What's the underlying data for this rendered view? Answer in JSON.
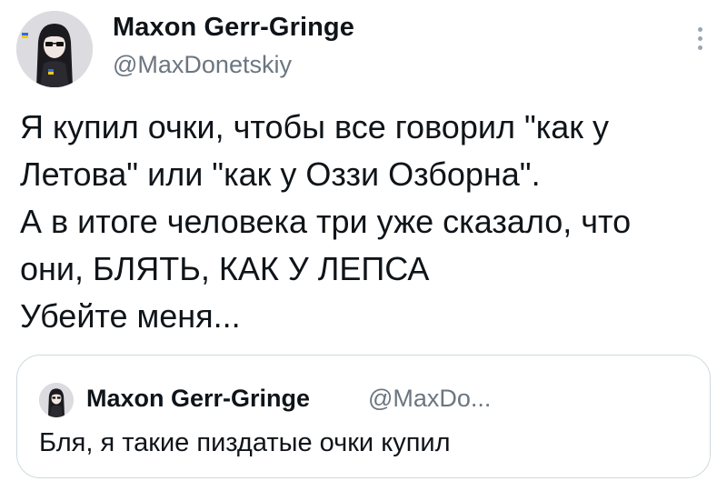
{
  "author": {
    "display_name": "Maxon Gerr-Gringe",
    "handle": "@MaxDonetskiy",
    "avatar_icon": "avatar-girl-glasses-icon"
  },
  "more_icon": "more-vertical-icon",
  "tweet": {
    "lines": [
      "Я купил очки, чтобы все говорил \"как у",
      "Летова\" или \"как у Оззи Озборна\".",
      "А в итоге человека три уже сказало, что",
      "они, БЛЯТЬ, КАК У ЛЕПСА",
      "Убейте меня..."
    ]
  },
  "quoted_tweet": {
    "display_name": "Maxon Gerr-Gringe",
    "handle": "@MaxDo...",
    "text": "Бля, я такие пиздатые очки купил"
  },
  "colors": {
    "text": "#0f1419",
    "secondary": "#6b7680",
    "border": "#cfd9de"
  }
}
